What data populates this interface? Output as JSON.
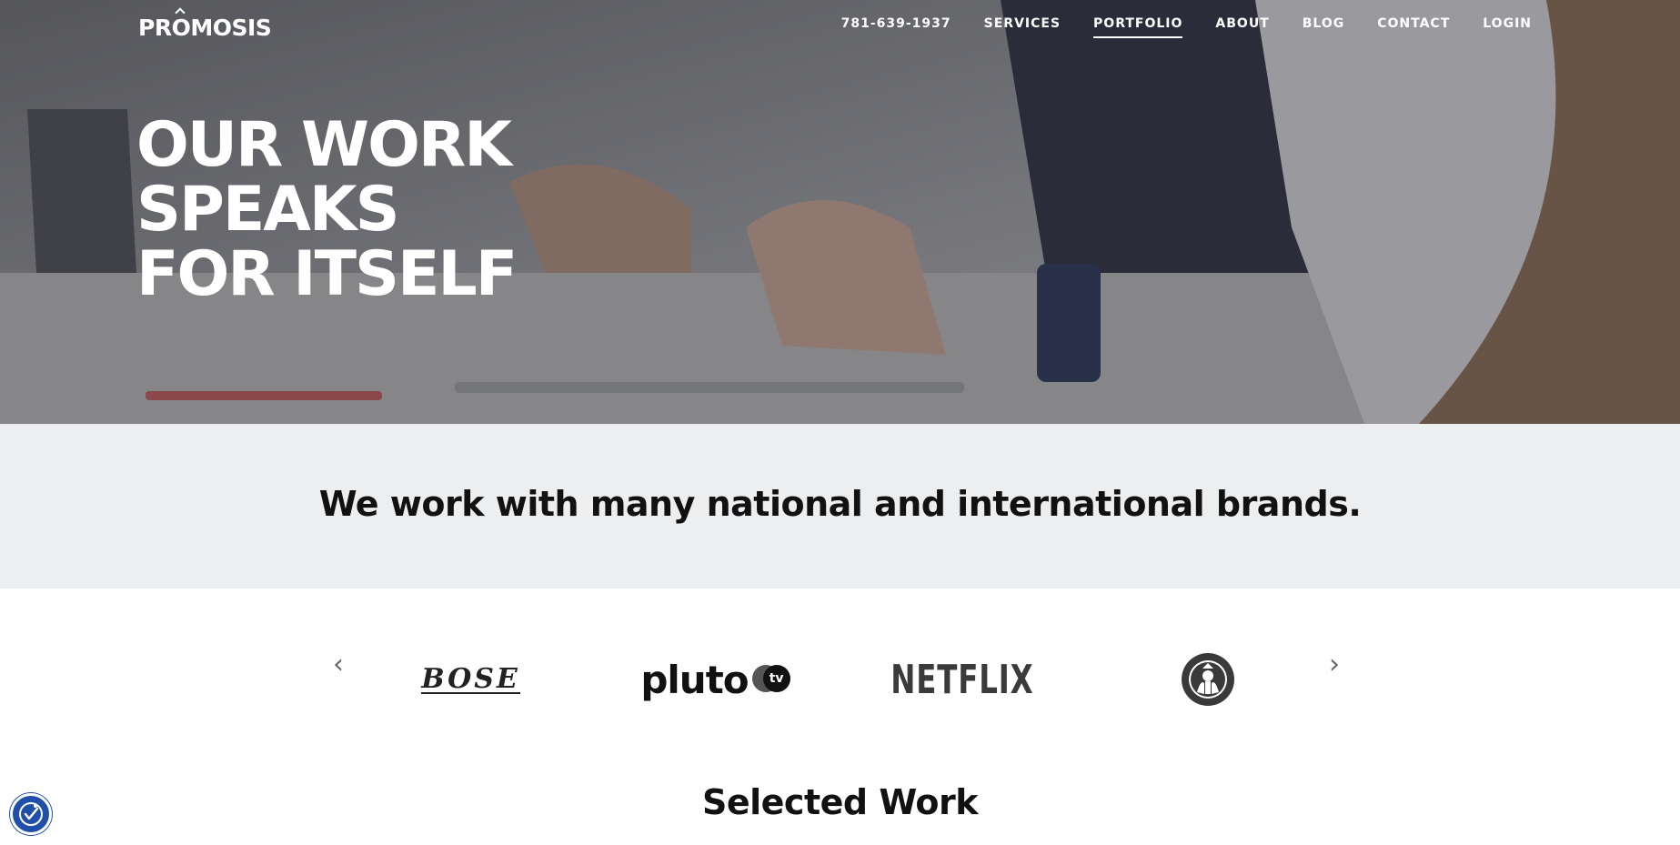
{
  "brand": {
    "logo": "PROMOSIS"
  },
  "nav": {
    "phone": "781-639-1937",
    "items": [
      "SERVICES",
      "PORTFOLIO",
      "ABOUT",
      "BLOG",
      "CONTACT",
      "LOGIN"
    ],
    "active": "PORTFOLIO"
  },
  "hero": {
    "lines": [
      "OUR WORK",
      "SPEAKS",
      "FOR ITSELF"
    ]
  },
  "brands_band": {
    "heading": "We work with many national and international brands."
  },
  "carousel": {
    "prev_icon": "chevron-left-icon",
    "next_icon": "chevron-right-icon",
    "prev_glyph": "‹",
    "next_glyph": "›",
    "logos": [
      {
        "name": "BOSE",
        "text": "BOSE"
      },
      {
        "name": "pluto tv",
        "text": "pluto",
        "badge": "tv"
      },
      {
        "name": "NETFLIX",
        "text": "NETFLIX"
      },
      {
        "name": "Starbucks",
        "icon": "starbucks-siren-icon"
      }
    ]
  },
  "section": {
    "title": "Selected Work"
  },
  "accessibility": {
    "icon": "accessibility-icon",
    "color": "#1f4fa8"
  }
}
